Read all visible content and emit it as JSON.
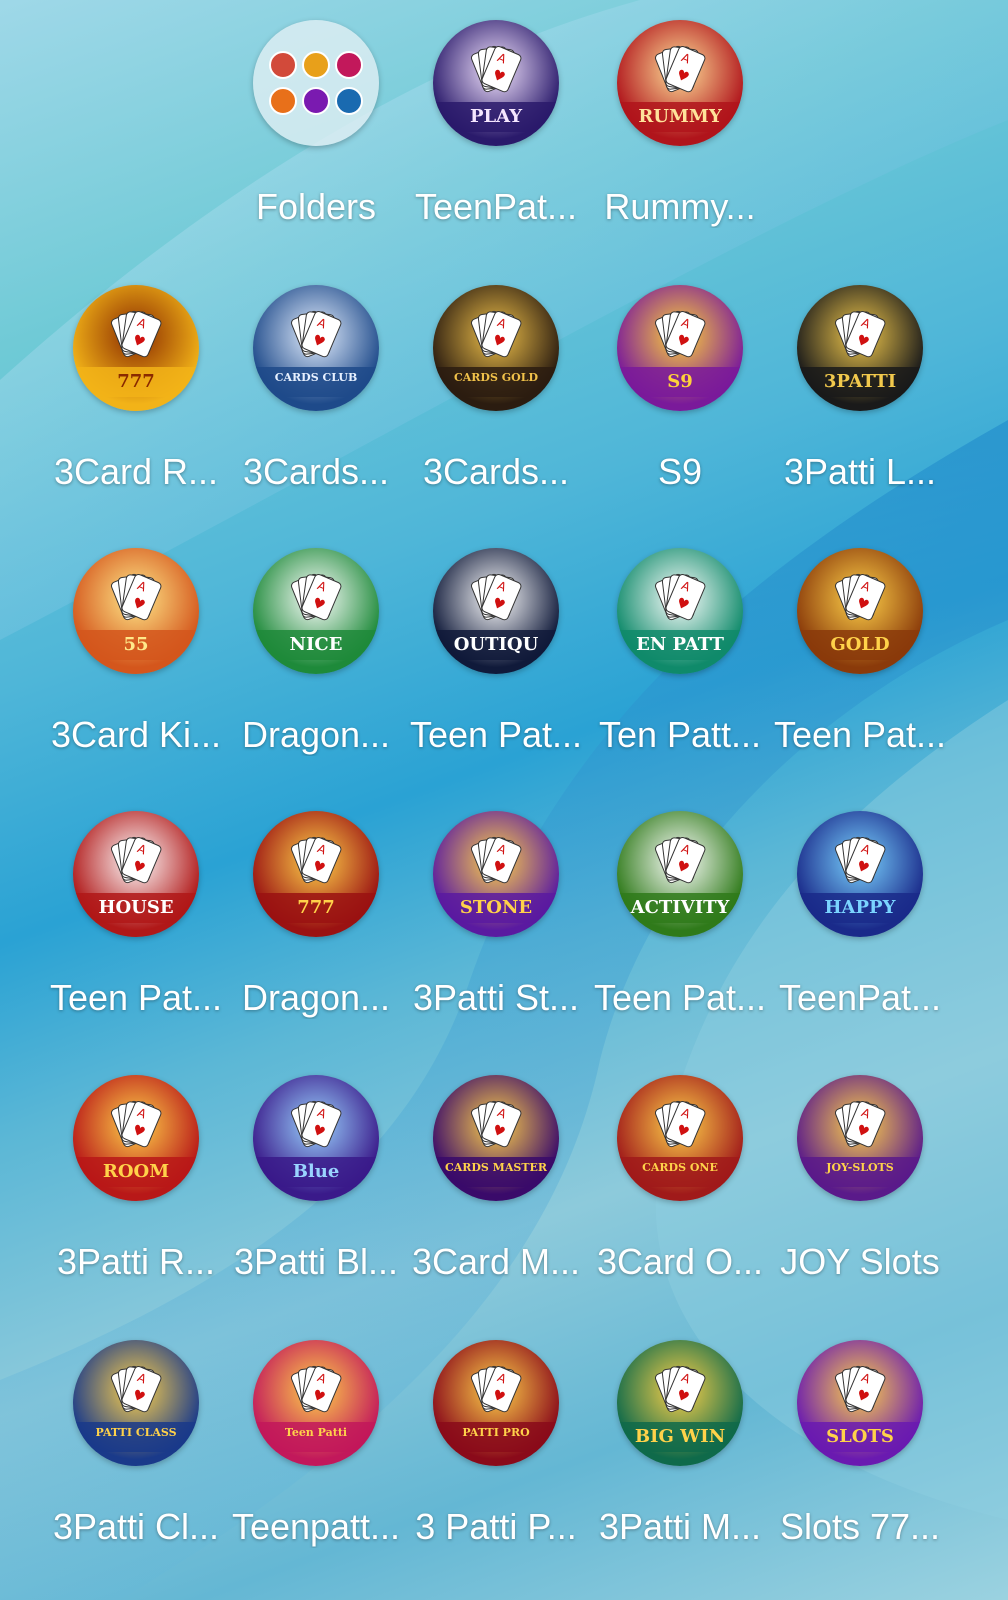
{
  "apps": [
    {
      "label": "Folders",
      "icon": "folder-icon",
      "icon_text": ""
    },
    {
      "label": "TeenPat...",
      "icon": "teenpatti-play-icon",
      "icon_text": "PLAY"
    },
    {
      "label": "Rummy...",
      "icon": "rummy-east-icon",
      "icon_text": "RUMMY"
    },
    {
      "label": "3Card R...",
      "icon": "3card-royal-icon",
      "icon_text": "777"
    },
    {
      "label": "3Cards...",
      "icon": "3cards-club-icon",
      "icon_text": "CARDS CLUB"
    },
    {
      "label": "3Cards...",
      "icon": "3cards-gold-icon",
      "icon_text": "CARDS GOLD"
    },
    {
      "label": "S9",
      "icon": "s9-icon",
      "icon_text": "S9"
    },
    {
      "label": "3Patti L...",
      "icon": "3patti-loot-icon",
      "icon_text": "3PATTI"
    },
    {
      "label": "3Card Ki...",
      "icon": "3card-king-icon",
      "icon_text": "55"
    },
    {
      "label": "Dragon...",
      "icon": "dragon-tiger-nice-icon",
      "icon_text": "NICE"
    },
    {
      "label": "Teen Pat...",
      "icon": "teenpatti-boutique-icon",
      "icon_text": "OUTIQU"
    },
    {
      "label": "Ten Patt...",
      "icon": "ten-patti-icon",
      "icon_text": "EN PATT"
    },
    {
      "label": "Teen Pat...",
      "icon": "teenpatti-gold-icon",
      "icon_text": "GOLD"
    },
    {
      "label": "Teen Pat...",
      "icon": "teenpatti-house-icon",
      "icon_text": "HOUSE"
    },
    {
      "label": "Dragon...",
      "icon": "dragon-tiger-777-icon",
      "icon_text": "777"
    },
    {
      "label": "3Patti St...",
      "icon": "3patti-stone-icon",
      "icon_text": "STONE"
    },
    {
      "label": "Teen Pat...",
      "icon": "teenpatti-activity-icon",
      "icon_text": "ACTIVITY"
    },
    {
      "label": "TeenPat...",
      "icon": "teenpatti-happy-club-icon",
      "icon_text": "HAPPY"
    },
    {
      "label": "3Patti R...",
      "icon": "3patti-room-icon",
      "icon_text": "ROOM"
    },
    {
      "label": "3Patti Bl...",
      "icon": "3patti-blue-icon",
      "icon_text": "Blue"
    },
    {
      "label": "3Card M...",
      "icon": "3card-master-icon",
      "icon_text": "CARDS MASTER"
    },
    {
      "label": "3Card O...",
      "icon": "3card-one-icon",
      "icon_text": "CARDS ONE"
    },
    {
      "label": "JOY Slots",
      "icon": "joy-slots-icon",
      "icon_text": "JOY-SLOTS"
    },
    {
      "label": "3Patti Cl...",
      "icon": "3patti-classic-icon",
      "icon_text": "PATTI CLASS"
    },
    {
      "label": "Teenpatt...",
      "icon": "teenpatti-icon",
      "icon_text": "Teen Patti"
    },
    {
      "label": "3 Patti P...",
      "icon": "3patti-pro-icon",
      "icon_text": "PATTI PRO"
    },
    {
      "label": "3Patti M...",
      "icon": "3patti-master-icon",
      "icon_text": "BIG WIN"
    },
    {
      "label": "Slots 77...",
      "icon": "slots-777-icon",
      "icon_text": "SLOTS"
    }
  ],
  "colors": {
    "label": "#ffffff",
    "wallpaper_light": "#9fd8e8",
    "wallpaper_deep": "#2aa2d4"
  }
}
